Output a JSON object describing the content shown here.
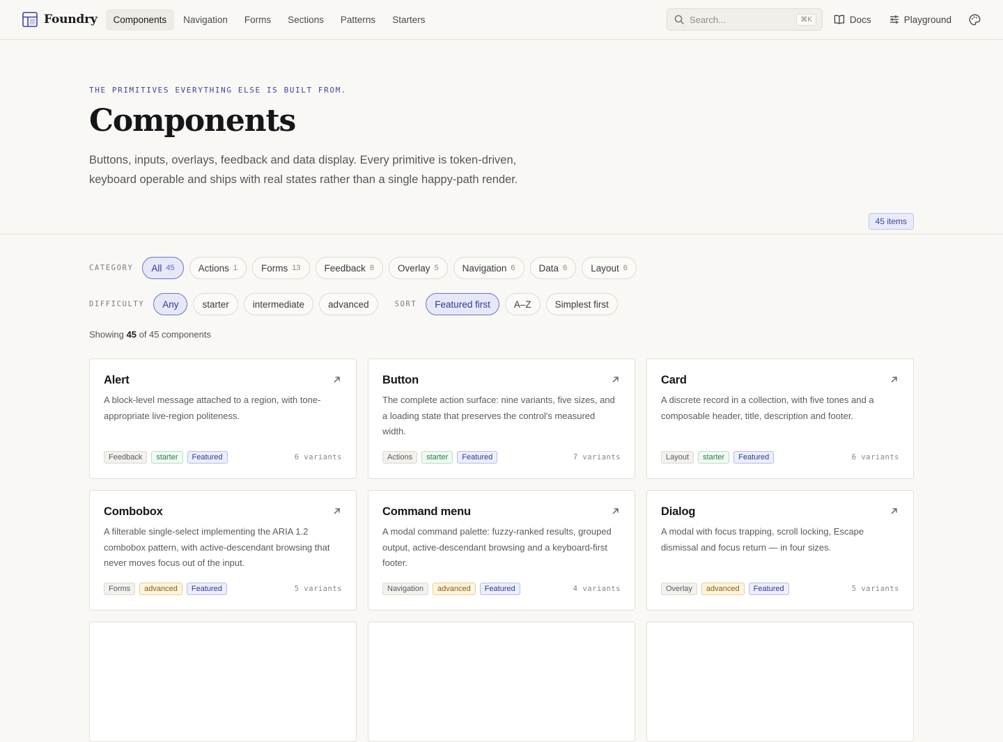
{
  "brand": {
    "name": "Foundry",
    "accent": "#3b44a8"
  },
  "nav": [
    {
      "label": "Components",
      "active": true
    },
    {
      "label": "Navigation"
    },
    {
      "label": "Forms"
    },
    {
      "label": "Sections"
    },
    {
      "label": "Patterns"
    },
    {
      "label": "Starters"
    }
  ],
  "search": {
    "placeholder": "Search...",
    "shortcut": "⌘K"
  },
  "top_links": {
    "docs": "Docs",
    "playground": "Playground"
  },
  "hero": {
    "eyebrow": "THE PRIMITIVES EVERYTHING ELSE IS BUILT FROM.",
    "title": "Components",
    "description": "Buttons, inputs, overlays, feedback and data display. Every primitive is token-driven, keyboard operable and ships with real states rather than a single happy-path render.",
    "count": "45 items"
  },
  "filters": {
    "category_label": "CATEGORY",
    "categories": [
      {
        "label": "All",
        "count": "45",
        "active": true
      },
      {
        "label": "Actions",
        "count": "1"
      },
      {
        "label": "Forms",
        "count": "13"
      },
      {
        "label": "Feedback",
        "count": "8"
      },
      {
        "label": "Overlay",
        "count": "5"
      },
      {
        "label": "Navigation",
        "count": "6"
      },
      {
        "label": "Data",
        "count": "6"
      },
      {
        "label": "Layout",
        "count": "6"
      }
    ],
    "difficulty_label": "DIFFICULTY",
    "difficulties": [
      {
        "label": "Any",
        "active": true
      },
      {
        "label": "starter"
      },
      {
        "label": "intermediate"
      },
      {
        "label": "advanced"
      }
    ],
    "sort_label": "SORT",
    "sorts": [
      {
        "label": "Featured first",
        "active": true
      },
      {
        "label": "A–Z"
      },
      {
        "label": "Simplest first"
      }
    ]
  },
  "showing": {
    "prefix": "Showing",
    "shown": "45",
    "suffix": "of 45 components"
  },
  "cards": [
    {
      "title": "Alert",
      "description": "A block-level message attached to a region, with tone-appropriate live-region politeness.",
      "category": "Feedback",
      "difficulty": "starter",
      "featured": "Featured",
      "variants": "6 variants"
    },
    {
      "title": "Button",
      "description": "The complete action surface: nine variants, five sizes, and a loading state that preserves the control's measured width.",
      "category": "Actions",
      "difficulty": "starter",
      "featured": "Featured",
      "variants": "7 variants"
    },
    {
      "title": "Card",
      "description": "A discrete record in a collection, with five tones and a composable header, title, description and footer.",
      "category": "Layout",
      "difficulty": "starter",
      "featured": "Featured",
      "variants": "6 variants"
    },
    {
      "title": "Combobox",
      "description": "A filterable single-select implementing the ARIA 1.2 combobox pattern, with active-descendant browsing that never moves focus out of the input.",
      "category": "Forms",
      "difficulty": "advanced",
      "featured": "Featured",
      "variants": "5 variants"
    },
    {
      "title": "Command menu",
      "description": "A modal command palette: fuzzy-ranked results, grouped output, active-descendant browsing and a keyboard-first footer.",
      "category": "Navigation",
      "difficulty": "advanced",
      "featured": "Featured",
      "variants": "4 variants"
    },
    {
      "title": "Dialog",
      "description": "A modal with focus trapping, scroll locking, Escape dismissal and focus return — in four sizes.",
      "category": "Overlay",
      "difficulty": "advanced",
      "featured": "Featured",
      "variants": "5 variants"
    }
  ]
}
